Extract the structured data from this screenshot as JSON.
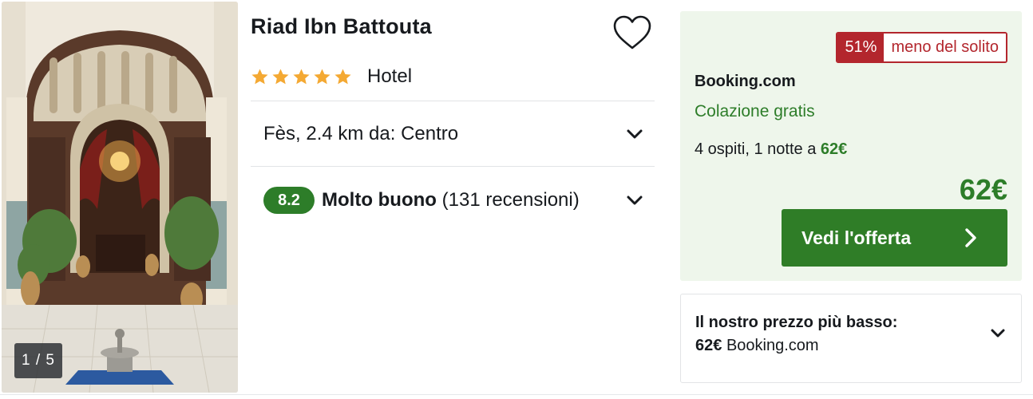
{
  "gallery": {
    "counter": "1 / 5",
    "photo_icon": "riad-courtyard-photo"
  },
  "hotel": {
    "name": "Riad Ibn Battouta",
    "stars": 5,
    "star_color": "#f4a933",
    "type": "Hotel",
    "favorite_icon": "heart-outline-icon"
  },
  "location": {
    "text": "Fès, 2.4 km da: Centro",
    "chevron_icon": "chevron-down-icon"
  },
  "rating": {
    "score": "8.2",
    "label": "Molto buono",
    "reviews": "(131 recensioni)",
    "chevron_icon": "chevron-down-icon",
    "color": "#2d7d29"
  },
  "deal": {
    "discount_percent": "51%",
    "discount_text": "meno del solito",
    "provider": "Booking.com",
    "perk": "Colazione gratis",
    "occupancy_prefix": "4 ospiti, 1 notte a",
    "occupancy_price": "62€",
    "price": "62€",
    "cta_label": "Vedi l'offerta",
    "cta_icon": "chevron-right-icon",
    "colors": {
      "background": "#eef6eb",
      "price_green": "#2d7d29",
      "discount_red": "#b3262d",
      "cta_green": "#2f7d27"
    }
  },
  "lowest_price": {
    "title": "Il nostro prezzo più basso:",
    "price": "62€",
    "provider": "Booking.com",
    "chevron_icon": "chevron-down-icon"
  }
}
